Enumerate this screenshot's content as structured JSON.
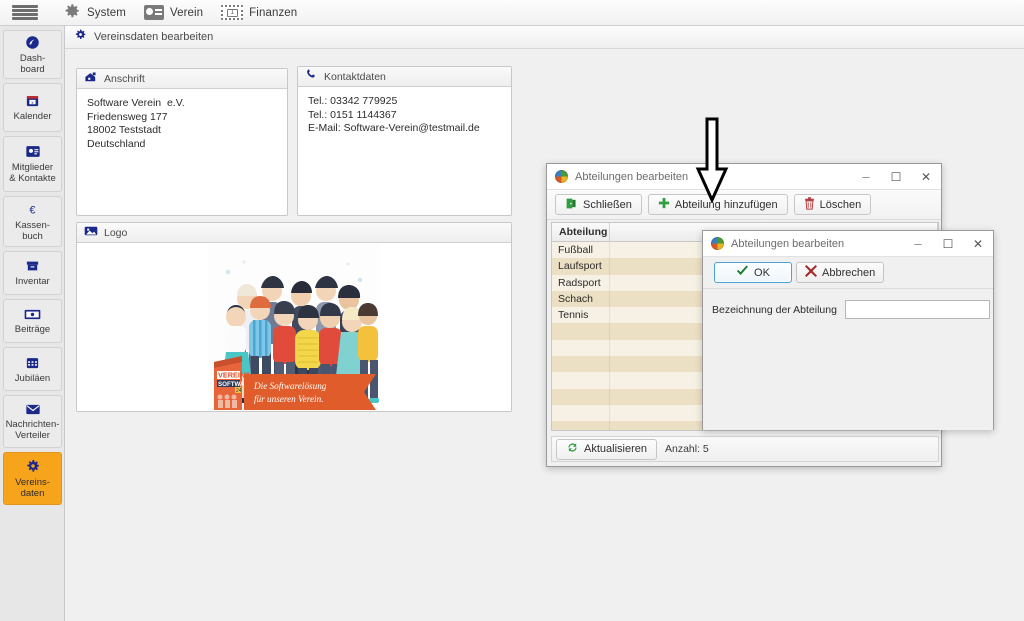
{
  "topbar": {
    "hamburger_name": "hamburger-menu",
    "items": [
      {
        "label": "System",
        "icon": "gear-icon"
      },
      {
        "label": "Verein",
        "icon": "contact-card-icon"
      },
      {
        "label": "Finanzen",
        "icon": "banknote-icon"
      }
    ]
  },
  "sidebar": {
    "items": [
      {
        "label": "Dash-\nboard",
        "icon": "dashboard-icon",
        "active": false
      },
      {
        "label": "Kalender",
        "icon": "calendar-icon",
        "active": false
      },
      {
        "label": "Mitglieder\n& Kontakte",
        "icon": "members-icon",
        "active": false
      },
      {
        "label": "Kassen-\nbuch",
        "icon": "euro-icon",
        "active": false
      },
      {
        "label": "Inventar",
        "icon": "box-icon",
        "active": false
      },
      {
        "label": "Beiträge",
        "icon": "banknote-icon",
        "active": false
      },
      {
        "label": "Jubiläen",
        "icon": "calendar-days-icon",
        "active": false
      },
      {
        "label": "Nachrichten-\nVerteiler",
        "icon": "envelope-icon",
        "active": false
      },
      {
        "label": "Vereins-\ndaten",
        "icon": "gear-icon",
        "active": true
      }
    ],
    "active_color": "#f7a41d"
  },
  "breadcrumb": {
    "icon": "gear-icon",
    "label": "Vereinsdaten bearbeiten"
  },
  "panels": {
    "anschrift": {
      "icon": "home-icon",
      "title": "Anschrift",
      "lines": [
        "Software Verein  e.V.",
        "Friedensweg 177",
        "18002 Teststadt",
        "Deutschland"
      ]
    },
    "kontakt": {
      "icon": "phone-icon",
      "title": "Kontaktdaten",
      "lines": [
        "Tel.: 03342 779925",
        "Tel.: 0151 1144367",
        "E-Mail: Software-Verein@testmail.de"
      ]
    },
    "logo": {
      "icon": "image-icon",
      "title": "Logo",
      "artwork": {
        "brand_line1": "VEREINS",
        "brand_line2": "SOFTWARE",
        "brand_line3": "24",
        "tagline_line1": "Die Softwarelösung",
        "tagline_line2": "für unseren Verein.",
        "banner_color": "#e05c2a"
      }
    }
  },
  "dialog_abteilungen": {
    "title": "Abteilungen bearbeiten",
    "icon": "globe-icon",
    "controls": {
      "minimize": "–",
      "maximize": "☐",
      "close": "✕"
    },
    "toolbar": [
      {
        "label": "Schließen",
        "icon": "exit-door-icon"
      },
      {
        "label": "Abteilung hinzufügen",
        "icon": "plus-icon"
      },
      {
        "label": "Löschen",
        "icon": "trash-icon"
      }
    ],
    "grid": {
      "columns": [
        "Abteilung"
      ],
      "rows": [
        "Fußball",
        "Laufsport",
        "Radsport",
        "Schach",
        "Tennis"
      ],
      "empty_rows": 8
    },
    "status": {
      "refresh_label": "Aktualisieren",
      "refresh_icon": "refresh-icon",
      "count_label": "Anzahl: 5"
    }
  },
  "dialog_modal": {
    "title": "Abteilungen bearbeiten",
    "icon": "globe-icon",
    "controls": {
      "minimize": "–",
      "maximize": "☐",
      "close": "✕"
    },
    "buttons": [
      {
        "label": "OK",
        "icon": "check-icon",
        "primary": true
      },
      {
        "label": "Abbrechen",
        "icon": "x-mark-icon",
        "primary": false
      }
    ],
    "field": {
      "label": "Bezeichnung der Abteilung",
      "value": "",
      "placeholder": ""
    }
  },
  "annotation": {
    "arrow": "down-arrow-outline",
    "points_at": "Abteilung hinzufügen"
  }
}
